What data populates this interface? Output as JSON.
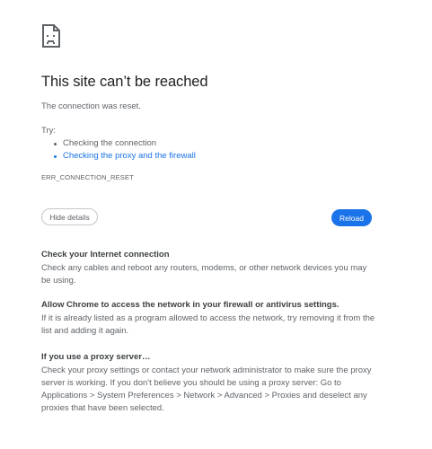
{
  "icon": "sad-page-icon",
  "error": {
    "title": "This site can’t be reached",
    "message": "The connection was reset.",
    "try_label": "Try:",
    "suggestions": [
      "Checking the connection",
      "Checking the proxy and the firewall"
    ],
    "code": "ERR_CONNECTION_RESET"
  },
  "buttons": {
    "details": "Hide details",
    "reload": "Reload"
  },
  "details": [
    {
      "title": "Check your Internet connection",
      "text": "Check any cables and reboot any routers, modems, or other network devices you may be using."
    },
    {
      "title": "Allow Chrome to access the network in your firewall or antivirus settings.",
      "text": "If it is already listed as a program allowed to access the network, try removing it from the list and adding it again."
    },
    {
      "title": "If you use a proxy server…",
      "text": "Check your proxy settings or contact your network administrator to make sure the proxy server is working. If you don't believe you should be using a proxy server: Go to Applications > System Preferences > Network > Advanced > Proxies and deselect any proxies that have been selected."
    }
  ],
  "colors": {
    "accent": "#1a73e8",
    "text_primary": "#202124",
    "text_secondary": "#5f6368"
  }
}
